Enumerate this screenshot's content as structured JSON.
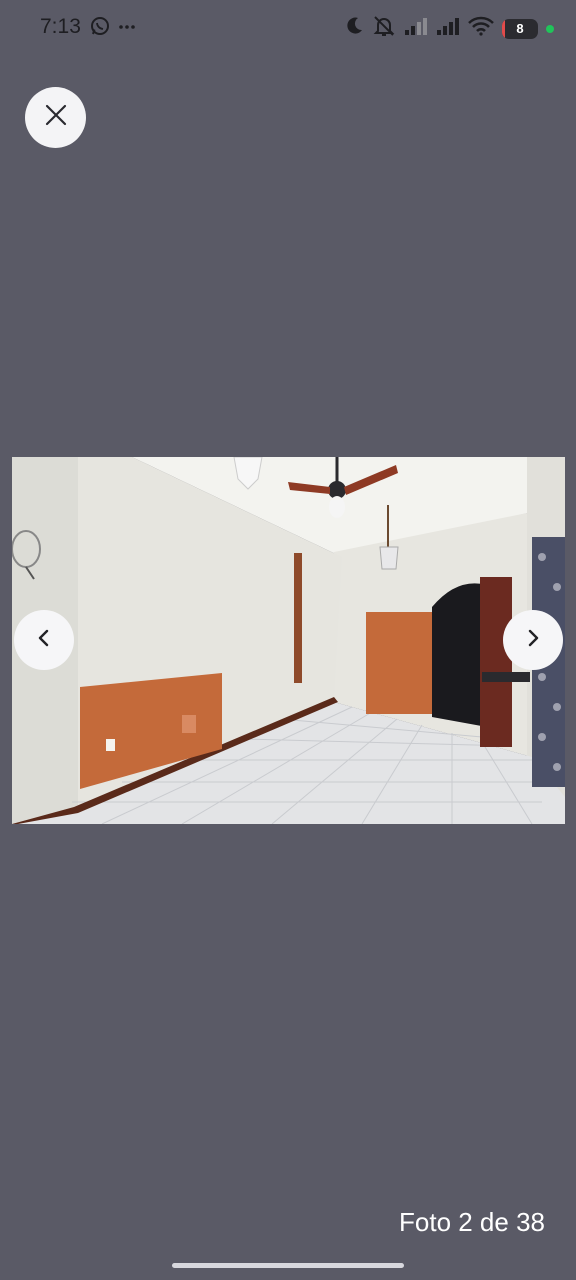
{
  "status_bar": {
    "time": "7:13",
    "left_icons": [
      "whatsapp-icon",
      "more-dots-icon"
    ],
    "right_icons": [
      "moon-icon",
      "bell-off-icon",
      "signal-icon",
      "signal-icon",
      "wifi-icon"
    ],
    "battery_level": "8",
    "battery_color": "#e24b4b",
    "dot_color": "#20c45a"
  },
  "viewer": {
    "close_icon": "close-icon",
    "prev_icon": "chevron-left-icon",
    "next_icon": "chevron-right-icon",
    "photo_counter": "Foto 2 de 38",
    "background_color": "#5a5a66"
  }
}
